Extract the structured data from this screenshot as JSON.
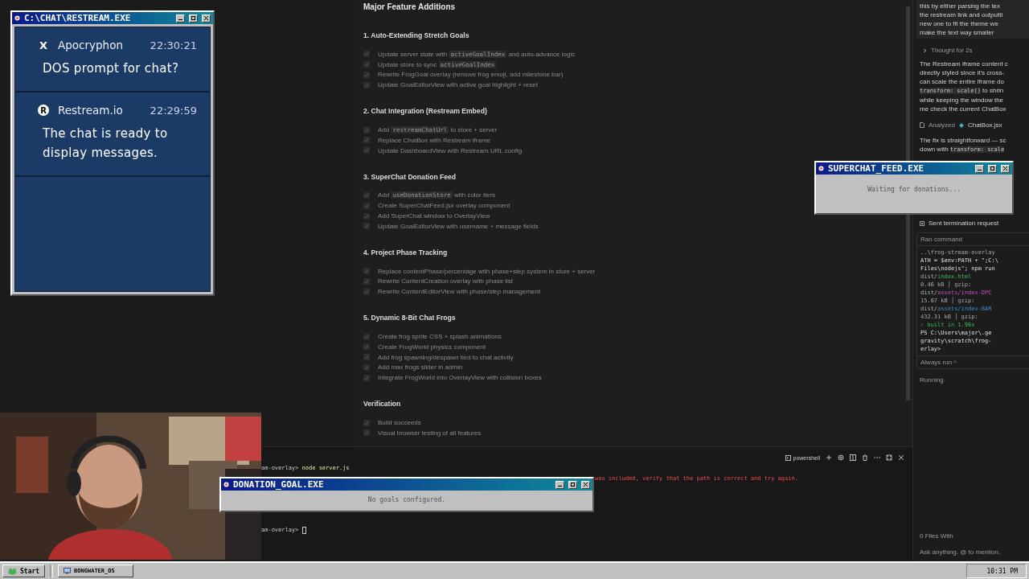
{
  "chat_window": {
    "title": "C:\\CHAT\\RESTREAM.EXE",
    "messages": [
      {
        "kind": "x",
        "icon": "X",
        "author": "Apocryphon",
        "time": "22:30:21",
        "text": "DOS prompt for chat?"
      },
      {
        "kind": "restream",
        "icon": "R",
        "author": "Restream.io",
        "time": "22:29:59",
        "text": "The chat is ready to display messages."
      }
    ]
  },
  "plan": {
    "title": "Major Feature Additions",
    "sections": [
      {
        "heading": "1. Auto-Extending Stretch Goals",
        "items": [
          {
            "checked": true,
            "parts": [
              {
                "kind": "plain",
                "text": "Update server state with "
              },
              {
                "kind": "code",
                "text": "activeGoalIndex"
              },
              {
                "kind": "plain",
                "text": " and auto-advance logic"
              }
            ]
          },
          {
            "checked": true,
            "parts": [
              {
                "kind": "plain",
                "text": "Update store to sync "
              },
              {
                "kind": "code",
                "text": "activeGoalIndex"
              }
            ]
          },
          {
            "checked": true,
            "parts": [
              {
                "kind": "plain",
                "text": "Rewrite FrogGoal overlay (remove frog emoji, add milestone bar)"
              }
            ]
          },
          {
            "checked": true,
            "parts": [
              {
                "kind": "plain",
                "text": "Update GoalEditorView with active goal highlight + reset"
              }
            ]
          }
        ]
      },
      {
        "heading": "2. Chat Integration (Restream Embed)",
        "items": [
          {
            "checked": true,
            "parts": [
              {
                "kind": "plain",
                "text": "Add "
              },
              {
                "kind": "code",
                "text": "restreamChatUrl"
              },
              {
                "kind": "plain",
                "text": " to store + server"
              }
            ]
          },
          {
            "checked": true,
            "parts": [
              {
                "kind": "plain",
                "text": "Replace ChatBox with Restream iframe"
              }
            ]
          },
          {
            "checked": true,
            "parts": [
              {
                "kind": "plain",
                "text": "Update DashboardView with Restream URL config"
              }
            ]
          }
        ]
      },
      {
        "heading": "3. SuperChat Donation Feed",
        "items": [
          {
            "checked": true,
            "parts": [
              {
                "kind": "plain",
                "text": "Add "
              },
              {
                "kind": "code",
                "text": "useDonationStore"
              },
              {
                "kind": "plain",
                "text": " with color tiers"
              }
            ]
          },
          {
            "checked": true,
            "parts": [
              {
                "kind": "plain",
                "text": "Create SuperChatFeed.jsx overlay component"
              }
            ]
          },
          {
            "checked": true,
            "parts": [
              {
                "kind": "plain",
                "text": "Add SuperChat window to OverlayView"
              }
            ]
          },
          {
            "checked": true,
            "parts": [
              {
                "kind": "plain",
                "text": "Update GoalEditorView with username + message fields"
              }
            ]
          }
        ]
      },
      {
        "heading": "4. Project Phase Tracking",
        "items": [
          {
            "checked": true,
            "parts": [
              {
                "kind": "plain",
                "text": "Replace contentPhase/percentage with phase+step system in store + server"
              }
            ]
          },
          {
            "checked": true,
            "parts": [
              {
                "kind": "plain",
                "text": "Rewrite ContentCreation overlay with phase list"
              }
            ]
          },
          {
            "checked": true,
            "parts": [
              {
                "kind": "plain",
                "text": "Rewrite ContentEditorView with phase/step management"
              }
            ]
          }
        ]
      },
      {
        "heading": "5. Dynamic 8-Bit Chat Frogs",
        "items": [
          {
            "checked": true,
            "parts": [
              {
                "kind": "plain",
                "text": "Create frog sprite CSS + splash animations"
              }
            ]
          },
          {
            "checked": true,
            "parts": [
              {
                "kind": "plain",
                "text": "Create FrogWorld physics component"
              }
            ]
          },
          {
            "checked": true,
            "parts": [
              {
                "kind": "plain",
                "text": "Add frog spawning/despawn tied to chat activity"
              }
            ]
          },
          {
            "checked": true,
            "parts": [
              {
                "kind": "plain",
                "text": "Add max frogs slider in admin"
              }
            ]
          },
          {
            "checked": true,
            "parts": [
              {
                "kind": "plain",
                "text": "Integrate FrogWorld into OverlayView with collision boxes"
              }
            ]
          }
        ]
      },
      {
        "heading": "Verification",
        "items": [
          {
            "checked": true,
            "parts": [
              {
                "kind": "plain",
                "text": "Build succeeds"
              }
            ]
          },
          {
            "checked": true,
            "parts": [
              {
                "kind": "plain",
                "text": "Visual browser testing of all features"
              }
            ]
          }
        ]
      }
    ]
  },
  "agent_panel": {
    "message_lines": [
      "this by either parsing the tex",
      "the restream link and outputti",
      "new one to fit the theme we",
      "make the text way smaller"
    ],
    "thought": "Thought for 2s",
    "paragraphs": [
      [
        [
          {
            "kind": "plain",
            "text": "The Restream iframe content c"
          }
        ],
        [
          {
            "kind": "plain",
            "text": "directly styled since it's cross-"
          }
        ],
        [
          {
            "kind": "plain",
            "text": "can scale the entire iframe do"
          }
        ],
        [
          {
            "kind": "code",
            "text": "transform: scale()"
          },
          {
            "kind": "plain",
            "text": " to shrin"
          }
        ],
        [
          {
            "kind": "plain",
            "text": "while keeping the window the"
          }
        ],
        [
          {
            "kind": "plain",
            "text": "me check the current ChatBox"
          }
        ]
      ]
    ],
    "analyzed": {
      "label": "Analyzed",
      "file": "ChatBox.jsx"
    },
    "fix_lines": [
      [
        {
          "kind": "plain",
          "text": "The fix is straightforward — sc"
        }
      ],
      [
        {
          "kind": "plain",
          "text": "down with "
        },
        {
          "kind": "code",
          "text": "transform: scale"
        }
      ]
    ],
    "termination": "Sent termination request",
    "command": {
      "title": "Ran command",
      "lines": [
        [
          {
            "kind": "dim",
            "text": "..\\frog-stream-overlay"
          }
        ],
        [
          {
            "kind": "plain",
            "text": "ATH = $env:PATH + \";C:\\"
          }
        ],
        [
          {
            "kind": "plain",
            "text": "Files\\nodejs\"; npm run"
          }
        ],
        [
          {
            "kind": "dim",
            "text": "  dist/"
          },
          {
            "kind": "file",
            "text": "index.html"
          }
        ],
        [
          {
            "kind": "dim",
            "text": "    0.46 kB │ gzip:"
          }
        ],
        [
          {
            "kind": "dim",
            "text": "  dist/"
          },
          {
            "kind": "asset",
            "text": "assets/index-DPC"
          }
        ],
        [
          {
            "kind": "dim",
            "text": "    15.67 kB │ gzip:"
          }
        ],
        [
          {
            "kind": "dim",
            "text": "  dist/"
          },
          {
            "kind": "link",
            "text": "assets/index-BAR"
          }
        ],
        [
          {
            "kind": "dim",
            "text": "    432.31 kB │ gzip:"
          }
        ],
        [
          {
            "kind": "success",
            "text": "  ✓ built in 1.96s"
          }
        ],
        [
          {
            "kind": "plain",
            "text": "PS C:\\Users\\major\\.ge"
          }
        ],
        [
          {
            "kind": "plain",
            "text": "gravity\\scratch\\frog-"
          }
        ],
        [
          {
            "kind": "plain",
            "text": "erlay> "
          }
        ]
      ],
      "always": "Always run ^"
    },
    "status": "Running",
    "files": "0 Files With",
    "input_placeholder": "Ask anything, @ to mention,"
  },
  "terminal": {
    "tab": "powershell",
    "lines": [
      {
        "kind": "prompt",
        "prompt": "am-overlay> ",
        "command": "node server.js"
      },
      {
        "kind": "error",
        "text": "was included, verify that the path is correct and try again."
      },
      {
        "kind": "prompt",
        "prompt": "am-overlay> "
      }
    ]
  },
  "superchat_window": {
    "title": "SUPERCHAT_FEED.EXE",
    "text": "Waiting for donations..."
  },
  "donation_window": {
    "title": "DONATION_GOAL.EXE",
    "text": "No goals configured."
  },
  "taskbar": {
    "start": "Start",
    "tasks": [
      {
        "label": "BONGWATER_OS",
        "selected": false
      }
    ],
    "clock": "10:31 PM"
  }
}
